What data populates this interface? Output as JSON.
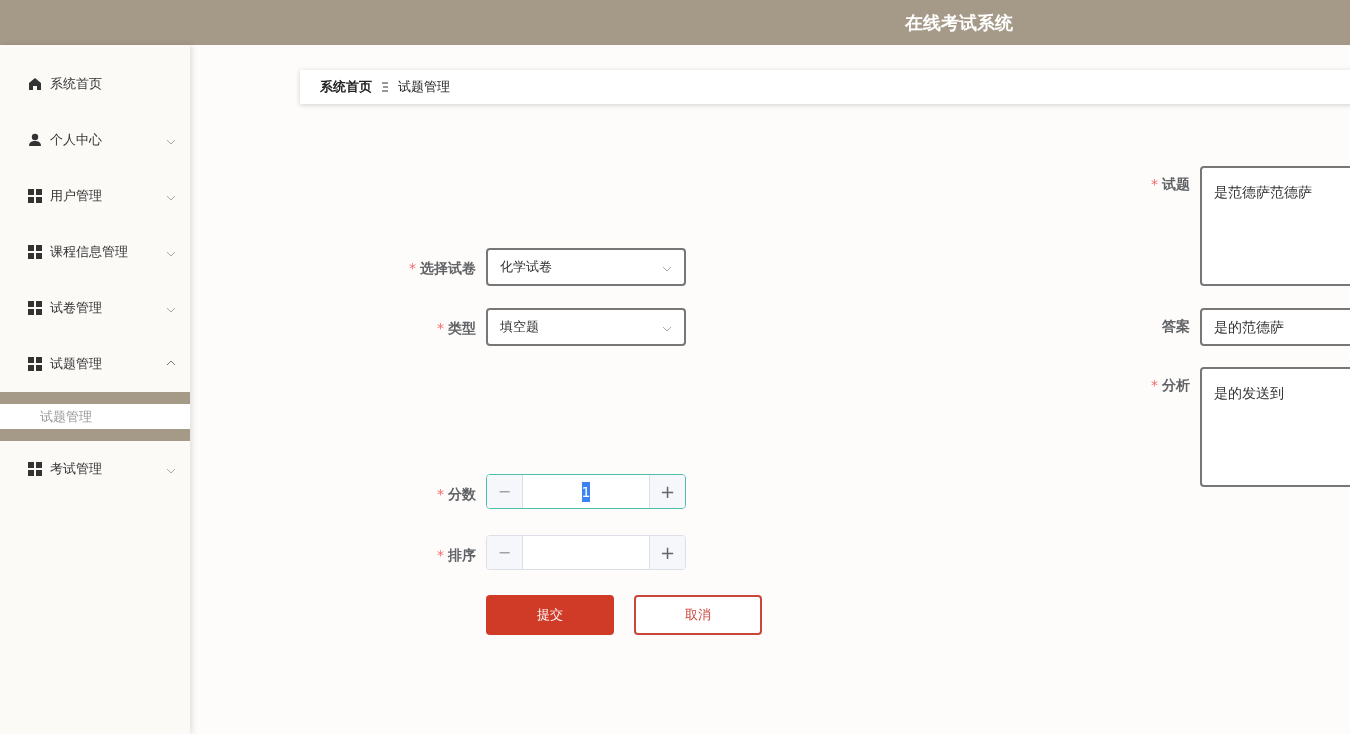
{
  "header": {
    "title": "在线考试系统"
  },
  "sidebar": {
    "items": [
      {
        "label": "系统首页",
        "kind": "home"
      },
      {
        "label": "个人中心",
        "kind": "user",
        "expanded": false
      },
      {
        "label": "用户管理",
        "kind": "grid",
        "expanded": false
      },
      {
        "label": "课程信息管理",
        "kind": "grid",
        "expanded": false
      },
      {
        "label": "试卷管理",
        "kind": "grid",
        "expanded": false
      },
      {
        "label": "试题管理",
        "kind": "grid",
        "expanded": true,
        "children": [
          {
            "label": "试题管理",
            "selected": true
          }
        ]
      },
      {
        "label": "考试管理",
        "kind": "grid",
        "expanded": false
      }
    ]
  },
  "breadcrumb": [
    "系统首页",
    "试题管理"
  ],
  "form": {
    "left": [
      {
        "kind": "select",
        "label": "选择试卷",
        "marker": "*",
        "value": "化学试卷"
      },
      {
        "kind": "select",
        "label": "类型",
        "marker": "*",
        "value": "填空题"
      },
      {
        "kind": "blank"
      },
      {
        "kind": "number",
        "label": "分数",
        "marker": "*",
        "value": "1",
        "focused": true,
        "minus": "−",
        "plus": "+"
      },
      {
        "kind": "number",
        "label": "排序",
        "marker": "*",
        "focused": false,
        "minus": "−",
        "plus": "+"
      }
    ],
    "right": [
      {
        "kind": "textarea",
        "label": "试题",
        "marker": "*",
        "value": "是范德萨范德萨"
      },
      {
        "kind": "text",
        "label": "答案",
        "value": "是的范德萨"
      },
      {
        "kind": "textarea",
        "label": "分析",
        "marker": "*",
        "value": "是的发送到"
      }
    ],
    "buttons": [
      {
        "label": "提交",
        "kind": "primary"
      },
      {
        "label": "取消",
        "kind": "secondary"
      }
    ]
  }
}
